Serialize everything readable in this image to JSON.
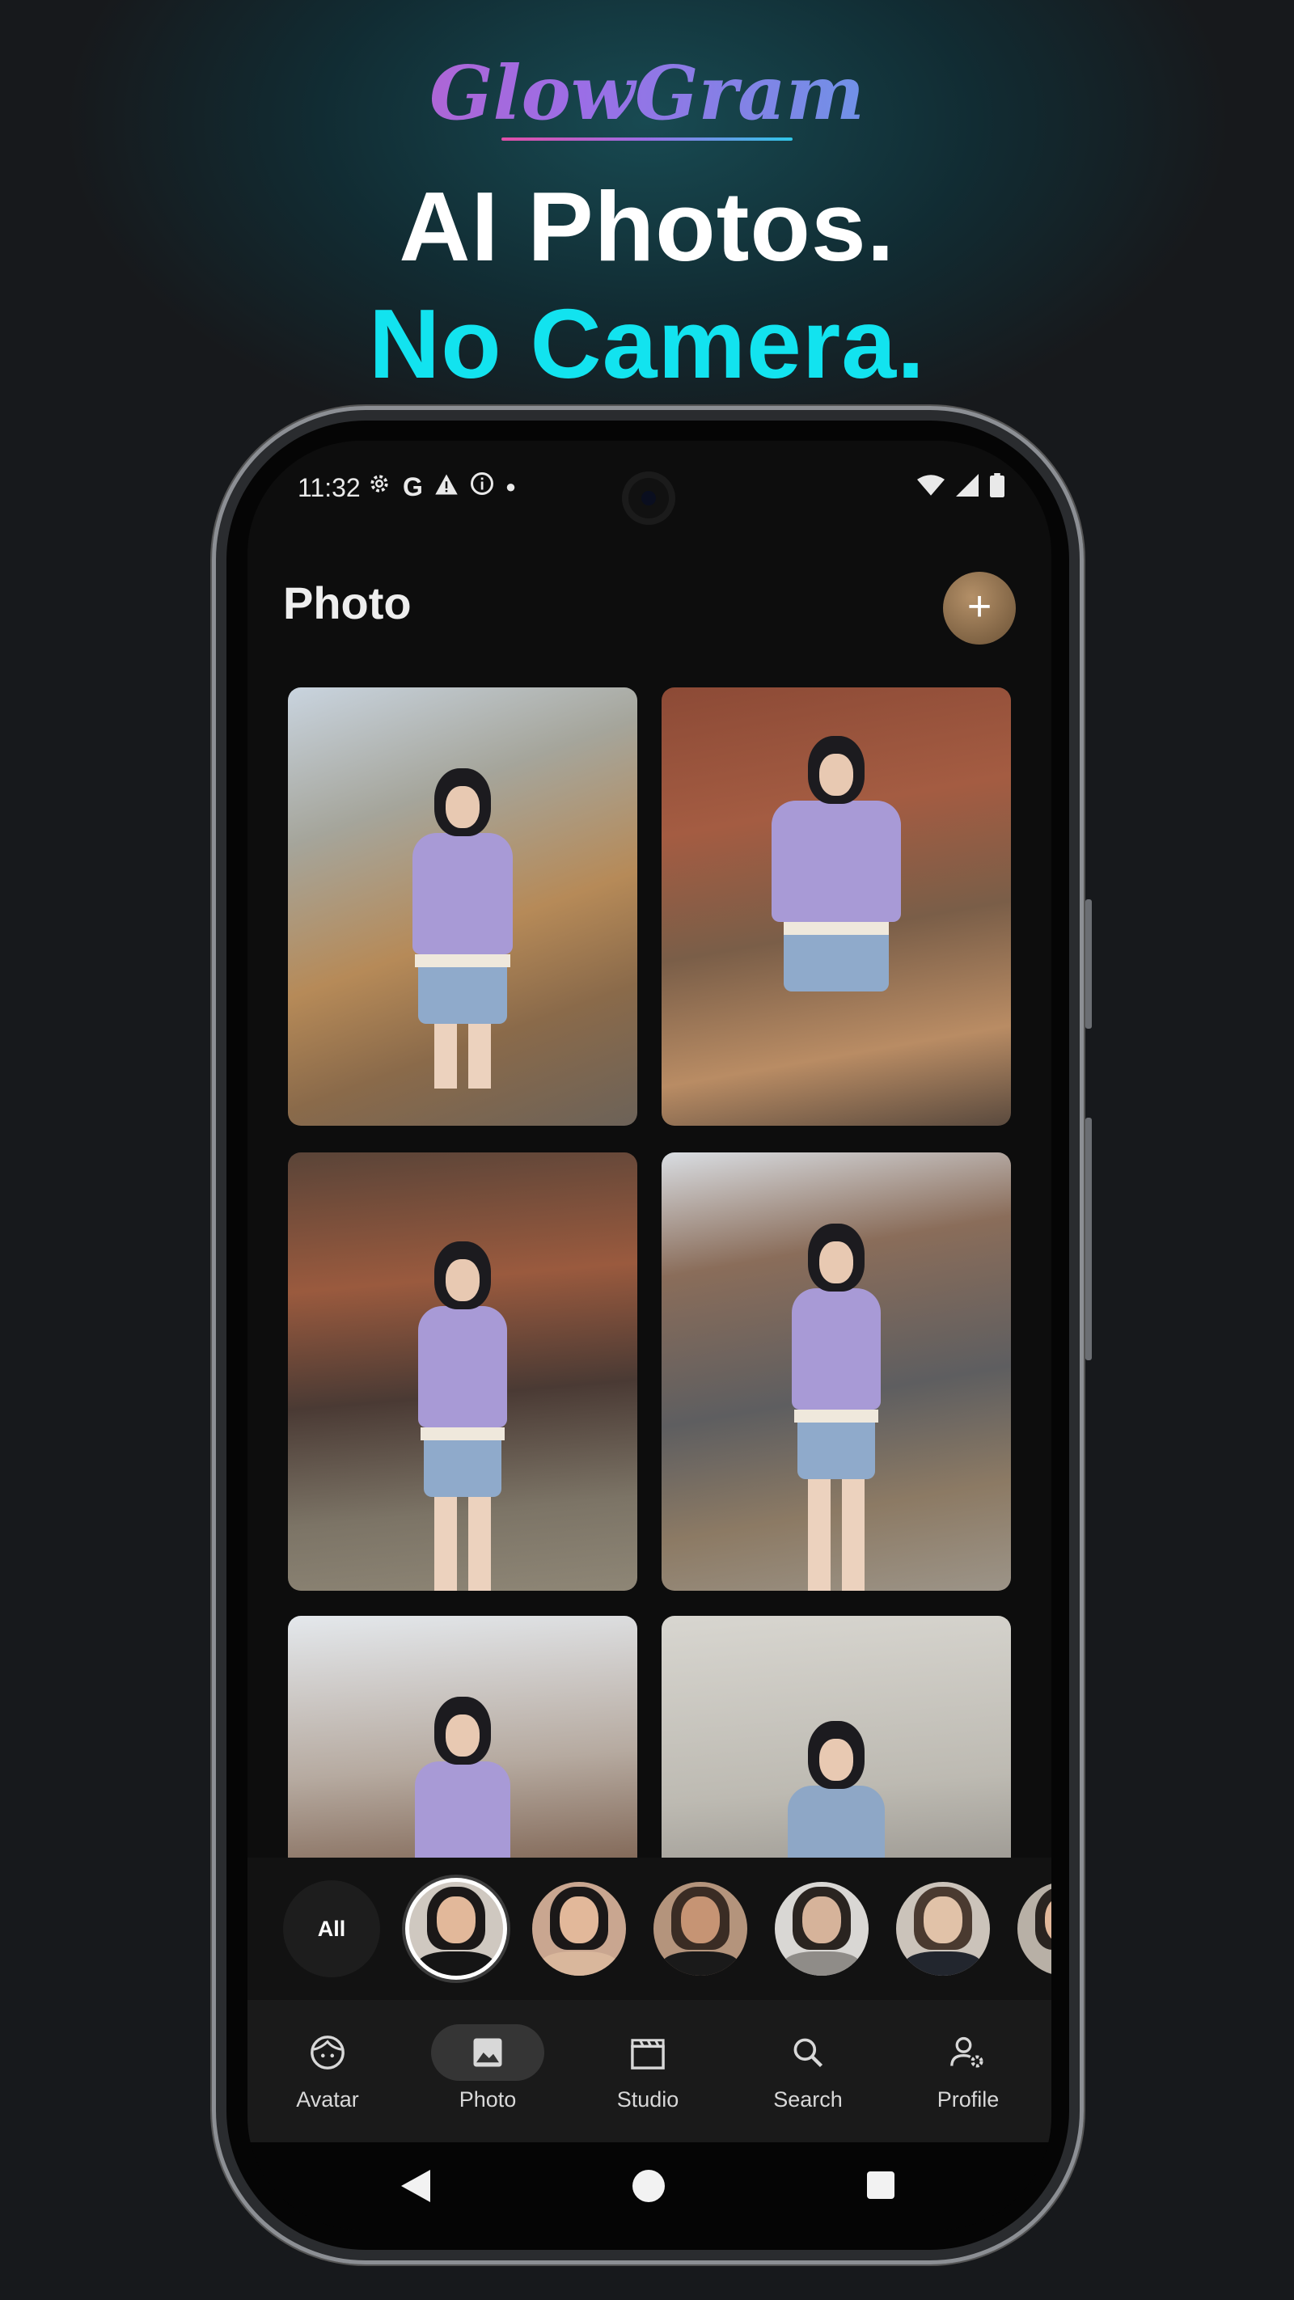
{
  "promo": {
    "logo": "GlowGram",
    "headline_line1": "AI Photos.",
    "headline_line2": "No Camera."
  },
  "status_bar": {
    "time": "11:32",
    "left_icons": [
      "gear-icon",
      "google-icon",
      "warning-icon",
      "info-icon",
      "dot-icon"
    ],
    "right_icons": [
      "wifi-icon",
      "signal-icon",
      "battery-icon"
    ]
  },
  "header": {
    "title": "Photo",
    "add_button_label": "+"
  },
  "avatar_strip": {
    "all_label": "All",
    "avatars": [
      {
        "name": "avatar-1",
        "selected": true
      },
      {
        "name": "avatar-2",
        "selected": false
      },
      {
        "name": "avatar-3",
        "selected": false
      },
      {
        "name": "avatar-4",
        "selected": false
      },
      {
        "name": "avatar-5",
        "selected": false
      },
      {
        "name": "avatar-6",
        "selected": false
      }
    ]
  },
  "bottom_nav": {
    "items": [
      {
        "label": "Avatar",
        "icon": "face-icon",
        "active": false
      },
      {
        "label": "Photo",
        "icon": "image-icon",
        "active": true
      },
      {
        "label": "Studio",
        "icon": "clapperboard-icon",
        "active": false
      },
      {
        "label": "Search",
        "icon": "search-icon",
        "active": false
      },
      {
        "label": "Profile",
        "icon": "user-settings-icon",
        "active": false
      }
    ]
  },
  "colors": {
    "accent_cyan": "#12e3ef",
    "add_button": "#8c6c48",
    "background": "#17191c"
  }
}
